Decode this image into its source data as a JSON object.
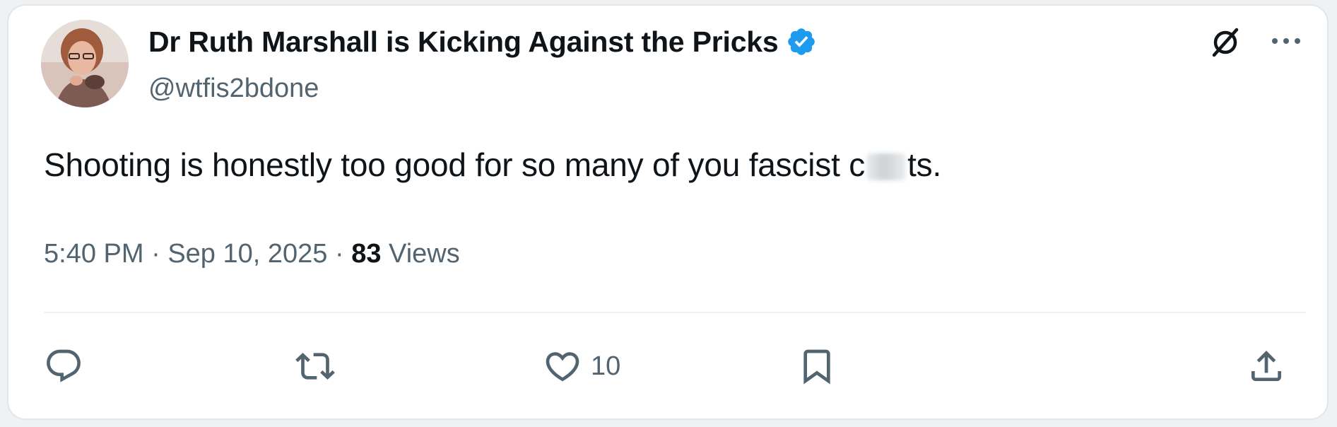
{
  "tweet": {
    "display_name": "Dr Ruth Marshall is Kicking Against the Pricks",
    "handle": "@wtfis2bdone",
    "text_before": "Shooting is honestly too good for so many of you fascist c",
    "text_after": "ts.",
    "time": "5:40 PM",
    "date": "Sep 10, 2025",
    "separator": "·",
    "views_count": "83",
    "views_label": "Views",
    "likes_count": "10"
  },
  "colors": {
    "primary_text": "#0f1419",
    "secondary_text": "#536471",
    "verified_blue": "#1d9bf0",
    "divider": "#eff3f4"
  },
  "icons": {
    "verified": "verified-badge-icon",
    "grok": "grok-icon",
    "more": "more-options-icon",
    "reply": "reply-icon",
    "retweet": "retweet-icon",
    "like": "heart-icon",
    "bookmark": "bookmark-icon",
    "share": "share-icon"
  }
}
